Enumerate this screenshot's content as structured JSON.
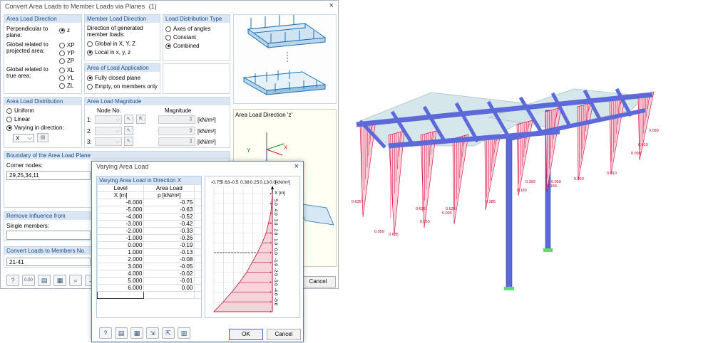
{
  "main_dialog": {
    "title": "Convert Area Loads to Member Loads via Planes",
    "title_suffix": "(1)",
    "close_glyph": "×",
    "area_load_direction": {
      "header": "Area Load Direction",
      "perpendicular_label": "Perpendicular to plane:",
      "global_projected_label": "Global related to projected area:",
      "global_true_label": "Global related to true area:",
      "options": [
        "z",
        "XP",
        "YP",
        "ZP",
        "XL",
        "YL",
        "ZL"
      ],
      "selected": "z"
    },
    "member_load_direction": {
      "header": "Member Load Direction",
      "description": "Direction of generated member loads:",
      "options": [
        "Global in X, Y, Z",
        "Local in x, y, z"
      ],
      "selected": "Local in x, y, z"
    },
    "load_distribution_type": {
      "header": "Load Distribution Type",
      "options": [
        "Axes of angles",
        "Constant",
        "Combined"
      ],
      "selected": "Combined"
    },
    "area_of_load_application": {
      "header": "Area of Load Application",
      "options": [
        "Fully closed plane",
        "Empty, on members only"
      ],
      "selected": "Fully closed plane"
    },
    "area_load_distribution": {
      "header": "Area Load Distribution",
      "options": [
        "Uniform",
        "Linear",
        "Varying in direction:"
      ],
      "selected": "Varying in direction:",
      "direction_value": "X"
    },
    "area_load_magnitude": {
      "header": "Area Load Magnitude",
      "node_no_header": "Node No.",
      "magnitude_header": "Magnitude",
      "rows": [
        "1:",
        "2:",
        "3:"
      ],
      "unit": "[kN/m²]"
    },
    "preview_caption": "Area Load Direction 'z'",
    "boundary": {
      "header": "Boundary of the Area Load Plane",
      "corner_label": "Corner nodes:",
      "corner_value": "29,25,34,11"
    },
    "remove_influence": {
      "header": "Remove Influence from",
      "single_members_label": "Single members:",
      "single_members_value": ""
    },
    "convert_to_members": {
      "header": "Convert Loads to Members No.",
      "value": "21-41"
    },
    "toolbar_icons": [
      "help-icon",
      "value-icon",
      "open-icon",
      "save-icon",
      "zoom-icon",
      "dimension-icon"
    ],
    "toolbar_glyphs": [
      "?",
      "0.00",
      "▤",
      "▦",
      "⌕",
      "↔"
    ],
    "cancel_label": "Cancel"
  },
  "varying_dialog": {
    "title": "Varying Area Load",
    "close_glyph": "×",
    "table_header": "Varying Area Load in Direction X",
    "col_level": "Level",
    "col_level_unit": "X [m]",
    "col_load": "Area Load",
    "col_load_unit": "p [kN/m²]",
    "rows": [
      {
        "level": "-6.000",
        "load": "-0.75"
      },
      {
        "level": "-5.000",
        "load": "-0.63"
      },
      {
        "level": "-4.000",
        "load": "-0.52"
      },
      {
        "level": "-3.000",
        "load": "-0.42"
      },
      {
        "level": "-2.000",
        "load": "-0.33"
      },
      {
        "level": "-1.000",
        "load": "-0.26"
      },
      {
        "level": "0.000",
        "load": "-0.19"
      },
      {
        "level": "1.000",
        "load": "-0.13"
      },
      {
        "level": "2.000",
        "load": "-0.08"
      },
      {
        "level": "3.000",
        "load": "-0.05"
      },
      {
        "level": "4.000",
        "load": "-0.02"
      },
      {
        "level": "5.000",
        "load": "-0.01"
      },
      {
        "level": "6.000",
        "load": "0.00"
      }
    ],
    "graph": {
      "top_tick_labels": [
        "-0.75",
        "0.63",
        "-0.5",
        "0.38",
        "0.25",
        "0.13",
        "0.0"
      ],
      "unit_label": "[kN/m²]",
      "axis_label": "X [m]",
      "side_tick_labels": [
        "5.0",
        "4.0",
        "3.0",
        "2.0",
        "1.0",
        "0.0",
        "-1.0",
        "-2.0",
        "-3.0",
        "-4.0",
        "-5.0"
      ]
    },
    "toolbar_icons": [
      "help-icon",
      "open-icon",
      "save-icon",
      "import-icon",
      "export-icon",
      "table-icon"
    ],
    "toolbar_glyphs": [
      "?",
      "▤",
      "▦",
      "⇲",
      "⇱",
      "▥"
    ],
    "ok_label": "OK",
    "cancel_label": "Cancel"
  },
  "model_view": {
    "load_labels": [
      "0.635",
      "0.635",
      "0.059",
      "0.635",
      "0.053",
      "0.635",
      "0.005",
      "0.385",
      "0.183",
      "0.393",
      "0.183",
      "0.059",
      "0.060",
      "0.010",
      "0.090",
      "0.010",
      "0.090"
    ]
  },
  "colors": {
    "group_header": "#dbe6f4",
    "group_header_text": "#1a4c8c",
    "member": "#5c69d8",
    "load": "#e0003a",
    "plane": "#cfe3e8"
  }
}
